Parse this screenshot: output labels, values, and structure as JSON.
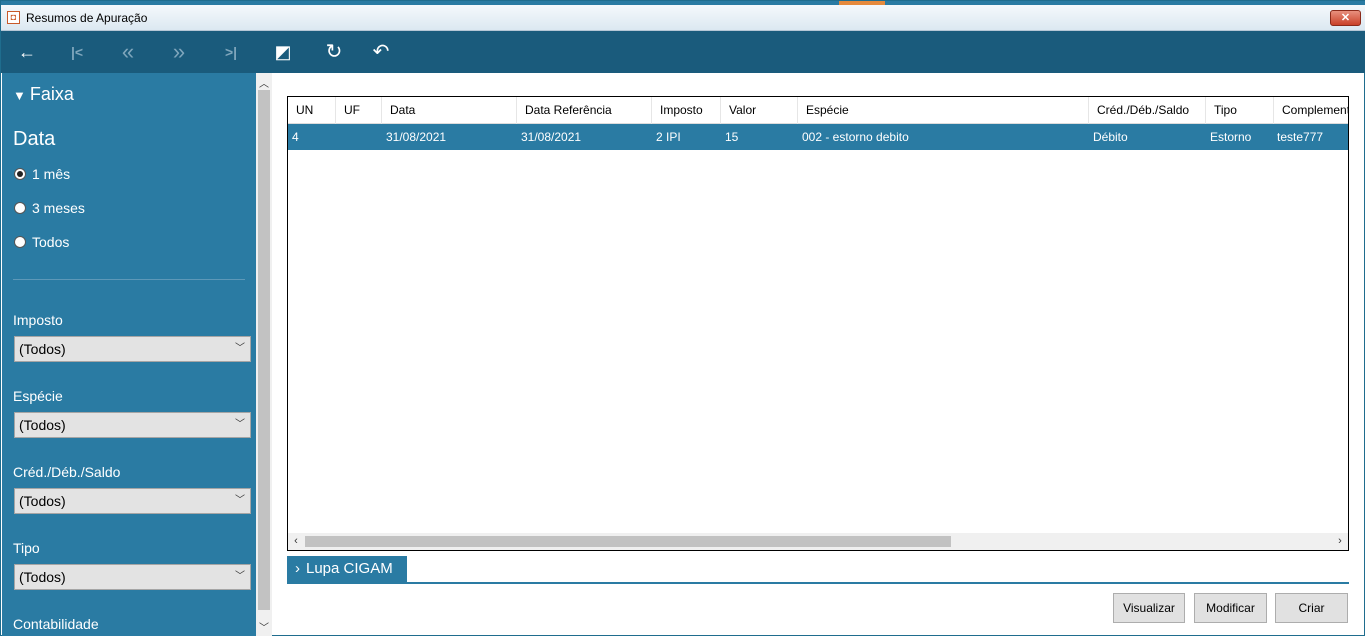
{
  "window": {
    "title": "Resumos de Apuração",
    "close_label": "✕"
  },
  "toolbar": {
    "back": "←",
    "first": "|<",
    "prev": "«",
    "next": "»",
    "last": ">|",
    "chart": "◩",
    "refresh": "↻",
    "undo": "↶"
  },
  "sidebar": {
    "section_title": "Faixa",
    "data_heading": "Data",
    "date_options": [
      "1 mês",
      "3 meses",
      "Todos"
    ],
    "selected_date": "1 mês",
    "filters": [
      {
        "label": "Imposto",
        "value": "(Todos)"
      },
      {
        "label": "Espécie",
        "value": "(Todos)"
      },
      {
        "label": "Créd./Déb./Saldo",
        "value": "(Todos)"
      },
      {
        "label": "Tipo",
        "value": "(Todos)"
      },
      {
        "label": "Contabilidade",
        "value": ""
      }
    ]
  },
  "grid": {
    "columns": [
      "UN",
      "UF",
      "Data",
      "Data Referência",
      "Imposto",
      "Valor",
      "Espécie",
      "Créd./Déb./Saldo",
      "Tipo",
      "Complemento"
    ],
    "rows": [
      [
        "4",
        "",
        "31/08/2021",
        "31/08/2021",
        "2 IPI",
        "15",
        "002 - estorno debito",
        "Débito",
        "Estorno",
        "teste777"
      ]
    ]
  },
  "lupa": {
    "label": "Lupa CIGAM"
  },
  "actions": {
    "visualizar": "Visualizar",
    "modificar": "Modificar",
    "criar": "Criar"
  },
  "colors": {
    "toolbar": "#1a5b7c",
    "sidebar": "#2a7ba3",
    "selected_row": "#2a7ba3"
  }
}
